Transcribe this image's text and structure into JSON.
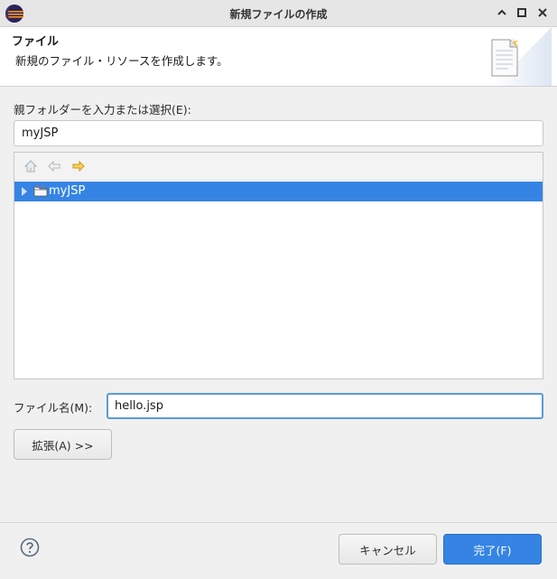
{
  "window": {
    "title": "新規ファイルの作成"
  },
  "header": {
    "title": "ファイル",
    "description": "新規のファイル・リソースを作成します。"
  },
  "parent_folder": {
    "label": "親フォルダーを入力または選択(E):",
    "value": "myJSP"
  },
  "tree": {
    "items": [
      {
        "label": "myJSP",
        "selected": true,
        "icon": "project-folder-icon"
      }
    ]
  },
  "file_name": {
    "label": "ファイル名(M):",
    "value": "hello.jsp"
  },
  "buttons": {
    "advanced": "拡張(A) >>",
    "cancel": "キャンセル",
    "finish": "完了(F)"
  },
  "colors": {
    "accent": "#3584e4",
    "focus_border": "#5b9bd5",
    "background": "#f0f0f0"
  }
}
